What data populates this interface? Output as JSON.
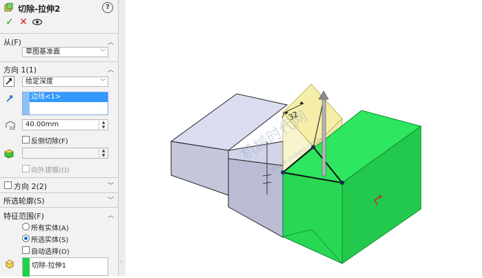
{
  "header": {
    "title": "切除-拉伸2",
    "help_label": "?"
  },
  "actions": {
    "ok_glyph": "✓",
    "cancel_glyph": "✕",
    "preview_glyph": "👁"
  },
  "from": {
    "label": "从(F)",
    "value": "草图基准面"
  },
  "direction1": {
    "label": "方向 1(1)",
    "end_condition": "给定深度",
    "selection_item": "边线<1>",
    "depth": "40.00mm",
    "flip_side_label": "反侧切除(F)",
    "draft_outward_label": "向外拔模(O)"
  },
  "direction2": {
    "label": "方向 2(2)"
  },
  "selected_contours": {
    "label": "所选轮廓(S)"
  },
  "feature_scope": {
    "label": "特征范围(F)",
    "all_bodies": "所有实体(A)",
    "selected_bodies": "所选实体(S)",
    "auto_select": "自动选择(O)",
    "body_item": "切除-拉伸1"
  },
  "viewport": {
    "dimension": "32",
    "watermark_cn": "机械时代网",
    "watermark_url": "www.jxaeo.com"
  },
  "colors": {
    "panel_bg": "#f2f2f2",
    "selection_blue": "#3399ff",
    "cut_body_green": "#22e65a",
    "preview_yellow": "#f4ec9a",
    "part_gray": "#c7c9de"
  }
}
